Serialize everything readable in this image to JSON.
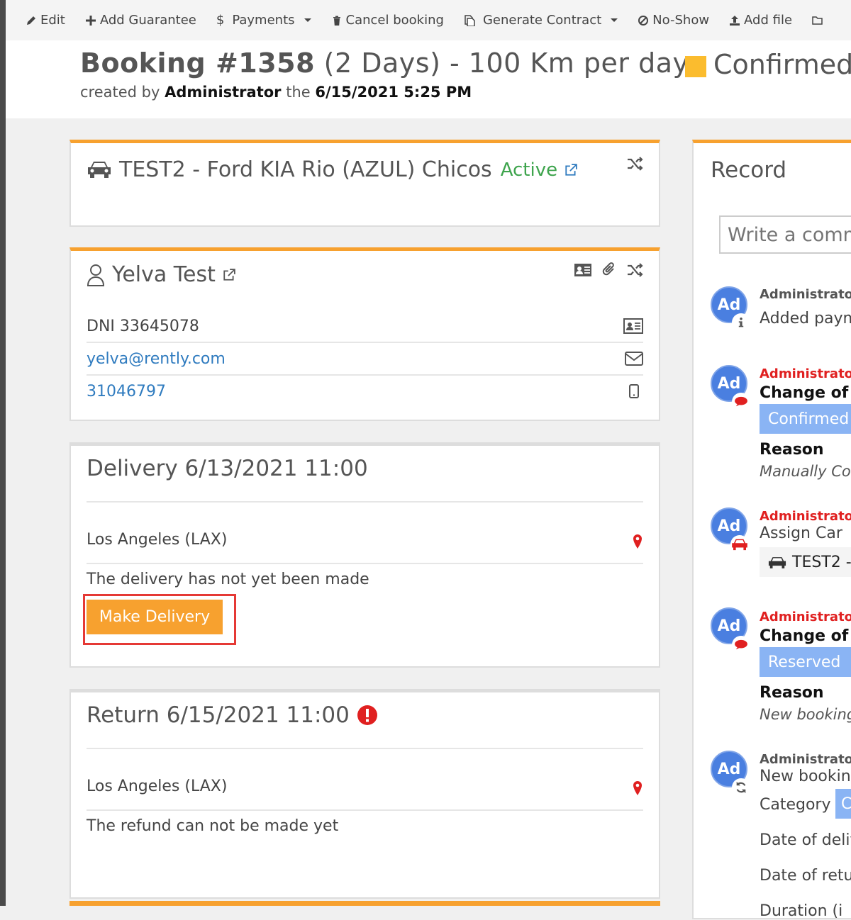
{
  "toolbar": {
    "edit": "Edit",
    "add_guarantee": "Add Guarantee",
    "payments": "Payments",
    "cancel_booking": "Cancel booking",
    "generate_contract": "Generate Contract",
    "no_show": "No-Show",
    "add_file": "Add file"
  },
  "header": {
    "booking_label": "Booking #1358",
    "booking_detail": "(2 Days) - 100 Km per day",
    "created_by_prefix": "created by",
    "created_by": "Administrator",
    "date_prefix": "the",
    "created_date": "6/15/2021 5:25 PM",
    "status": "Confirmed",
    "status_color": "#fbbc2e"
  },
  "car": {
    "name": "TEST2 - Ford KIA Rio (AZUL) Chicos",
    "status": "Active"
  },
  "client": {
    "name": "Yelva Test",
    "dni": "DNI 33645078",
    "email": "yelva@rently.com",
    "phone": "31046797"
  },
  "delivery": {
    "title": "Delivery 6/13/2021 11:00",
    "location": "Los Angeles (LAX)",
    "status_text": "The delivery has not yet been made",
    "button": "Make Delivery"
  },
  "return": {
    "title": "Return 6/15/2021 11:00",
    "location": "Los Angeles (LAX)",
    "status_text": "The refund can not be made yet"
  },
  "record": {
    "title": "Record",
    "comment_placeholder": "Write a comment",
    "entries": [
      {
        "avatar": "Ad",
        "author": "Administrato",
        "text": "Added paym"
      },
      {
        "avatar": "Ad",
        "author": "Administrato",
        "headline": "Change of",
        "badge": "Confirmed",
        "reason_label": "Reason",
        "reason": "Manually Co"
      },
      {
        "avatar": "Ad",
        "author": "Administrato",
        "text": "Assign Car",
        "chip": "TEST2 -"
      },
      {
        "avatar": "Ad",
        "author": "Administrato",
        "headline": "Change of",
        "badge": "Reserved",
        "reason_label": "Reason",
        "reason": "New booking"
      },
      {
        "avatar": "Ad",
        "author": "Administrato",
        "text": "New bookin",
        "category_label": "Category",
        "category_badge": "C",
        "line1": "Date of deliv",
        "line2": "Date of retu",
        "line3": "Duration (i"
      }
    ]
  },
  "colors": {
    "accent_orange": "#f7a12f",
    "active_green": "#3ea44d",
    "link_blue": "#2f7bbf",
    "badge_blue": "#8ab4f4",
    "alert_red": "#e02020"
  }
}
